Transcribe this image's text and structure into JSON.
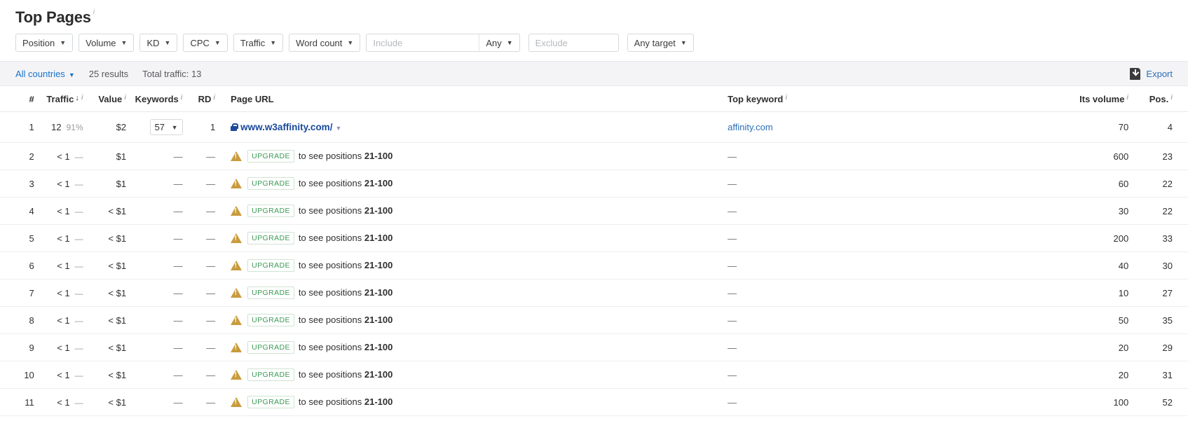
{
  "header": {
    "title": "Top Pages",
    "info_marker": "i"
  },
  "filters": [
    {
      "label": "Position",
      "caret": "▼"
    },
    {
      "label": "Volume",
      "caret": "▼"
    },
    {
      "label": "KD",
      "caret": "▼"
    },
    {
      "label": "CPC",
      "caret": "▼"
    },
    {
      "label": "Traffic",
      "caret": "▼"
    },
    {
      "label": "Word count",
      "caret": "▼"
    }
  ],
  "include": {
    "placeholder": "Include",
    "value": "",
    "mode_label": "Any",
    "caret": "▼"
  },
  "exclude": {
    "placeholder": "Exclude",
    "value": ""
  },
  "target": {
    "label": "Any target",
    "caret": "▼"
  },
  "subbar": {
    "countries_label": "All countries",
    "caret": "▼",
    "results": "25 results",
    "total_traffic": "Total traffic: 13",
    "export_label": "Export",
    "export_icon": "download-file-icon"
  },
  "table": {
    "columns": [
      {
        "key": "num",
        "label": "#",
        "info": "",
        "sort": ""
      },
      {
        "key": "traf",
        "label": "Traffic",
        "info": "i",
        "sort": "↓"
      },
      {
        "key": "val",
        "label": "Value",
        "info": "i",
        "sort": ""
      },
      {
        "key": "kw",
        "label": "Keywords",
        "info": "i",
        "sort": ""
      },
      {
        "key": "rd",
        "label": "RD",
        "info": "i",
        "sort": ""
      },
      {
        "key": "url",
        "label": "Page URL",
        "info": "",
        "sort": ""
      },
      {
        "key": "tkw",
        "label": "Top keyword",
        "info": "i",
        "sort": ""
      },
      {
        "key": "vol",
        "label": "Its volume",
        "info": "i",
        "sort": ""
      },
      {
        "key": "pos",
        "label": "Pos.",
        "info": "i",
        "sort": ""
      }
    ],
    "rows": [
      {
        "num": "1",
        "traffic": "12",
        "traffic_pct": "91%",
        "value": "$2",
        "keywords": "57",
        "keywords_caret": "▼",
        "rd": "1",
        "url_type": "link",
        "url": "www.w3affinity.com/",
        "url_caret": "▼",
        "top_keyword": "affinity.com",
        "top_keyword_type": "link",
        "its_volume": "70",
        "pos": "4"
      },
      {
        "num": "2",
        "traffic": "< 1",
        "traffic_pct": "—",
        "value": "$1",
        "keywords": "—",
        "rd": "—",
        "url_type": "upgrade",
        "badge": "UPGRADE",
        "upgrade_text": "to see positions",
        "upgrade_range": "21-100",
        "top_keyword": "—",
        "top_keyword_type": "dash",
        "its_volume": "600",
        "pos": "23"
      },
      {
        "num": "3",
        "traffic": "< 1",
        "traffic_pct": "—",
        "value": "$1",
        "keywords": "—",
        "rd": "—",
        "url_type": "upgrade",
        "badge": "UPGRADE",
        "upgrade_text": "to see positions",
        "upgrade_range": "21-100",
        "top_keyword": "—",
        "top_keyword_type": "dash",
        "its_volume": "60",
        "pos": "22"
      },
      {
        "num": "4",
        "traffic": "< 1",
        "traffic_pct": "—",
        "value": "< $1",
        "keywords": "—",
        "rd": "—",
        "url_type": "upgrade",
        "badge": "UPGRADE",
        "upgrade_text": "to see positions",
        "upgrade_range": "21-100",
        "top_keyword": "—",
        "top_keyword_type": "dash",
        "its_volume": "30",
        "pos": "22"
      },
      {
        "num": "5",
        "traffic": "< 1",
        "traffic_pct": "—",
        "value": "< $1",
        "keywords": "—",
        "rd": "—",
        "url_type": "upgrade",
        "badge": "UPGRADE",
        "upgrade_text": "to see positions",
        "upgrade_range": "21-100",
        "top_keyword": "—",
        "top_keyword_type": "dash",
        "its_volume": "200",
        "pos": "33"
      },
      {
        "num": "6",
        "traffic": "< 1",
        "traffic_pct": "—",
        "value": "< $1",
        "keywords": "—",
        "rd": "—",
        "url_type": "upgrade",
        "badge": "UPGRADE",
        "upgrade_text": "to see positions",
        "upgrade_range": "21-100",
        "top_keyword": "—",
        "top_keyword_type": "dash",
        "its_volume": "40",
        "pos": "30"
      },
      {
        "num": "7",
        "traffic": "< 1",
        "traffic_pct": "—",
        "value": "< $1",
        "keywords": "—",
        "rd": "—",
        "url_type": "upgrade",
        "badge": "UPGRADE",
        "upgrade_text": "to see positions",
        "upgrade_range": "21-100",
        "top_keyword": "—",
        "top_keyword_type": "dash",
        "its_volume": "10",
        "pos": "27"
      },
      {
        "num": "8",
        "traffic": "< 1",
        "traffic_pct": "—",
        "value": "< $1",
        "keywords": "—",
        "rd": "—",
        "url_type": "upgrade",
        "badge": "UPGRADE",
        "upgrade_text": "to see positions",
        "upgrade_range": "21-100",
        "top_keyword": "—",
        "top_keyword_type": "dash",
        "its_volume": "50",
        "pos": "35"
      },
      {
        "num": "9",
        "traffic": "< 1",
        "traffic_pct": "—",
        "value": "< $1",
        "keywords": "—",
        "rd": "—",
        "url_type": "upgrade",
        "badge": "UPGRADE",
        "upgrade_text": "to see positions",
        "upgrade_range": "21-100",
        "top_keyword": "—",
        "top_keyword_type": "dash",
        "its_volume": "20",
        "pos": "29"
      },
      {
        "num": "10",
        "traffic": "< 1",
        "traffic_pct": "—",
        "value": "< $1",
        "keywords": "—",
        "rd": "—",
        "url_type": "upgrade",
        "badge": "UPGRADE",
        "upgrade_text": "to see positions",
        "upgrade_range": "21-100",
        "top_keyword": "—",
        "top_keyword_type": "dash",
        "its_volume": "20",
        "pos": "31"
      },
      {
        "num": "11",
        "traffic": "< 1",
        "traffic_pct": "—",
        "value": "< $1",
        "keywords": "—",
        "rd": "—",
        "url_type": "upgrade",
        "badge": "UPGRADE",
        "upgrade_text": "to see positions",
        "upgrade_range": "21-100",
        "top_keyword": "—",
        "top_keyword_type": "dash",
        "its_volume": "100",
        "pos": "52"
      }
    ]
  },
  "colors": {
    "link": "#1a73c8",
    "url_link": "#19499c",
    "badge_green": "#3c9a55",
    "warn_amber": "#c89b3c",
    "subbar_bg": "#f4f4f7"
  }
}
